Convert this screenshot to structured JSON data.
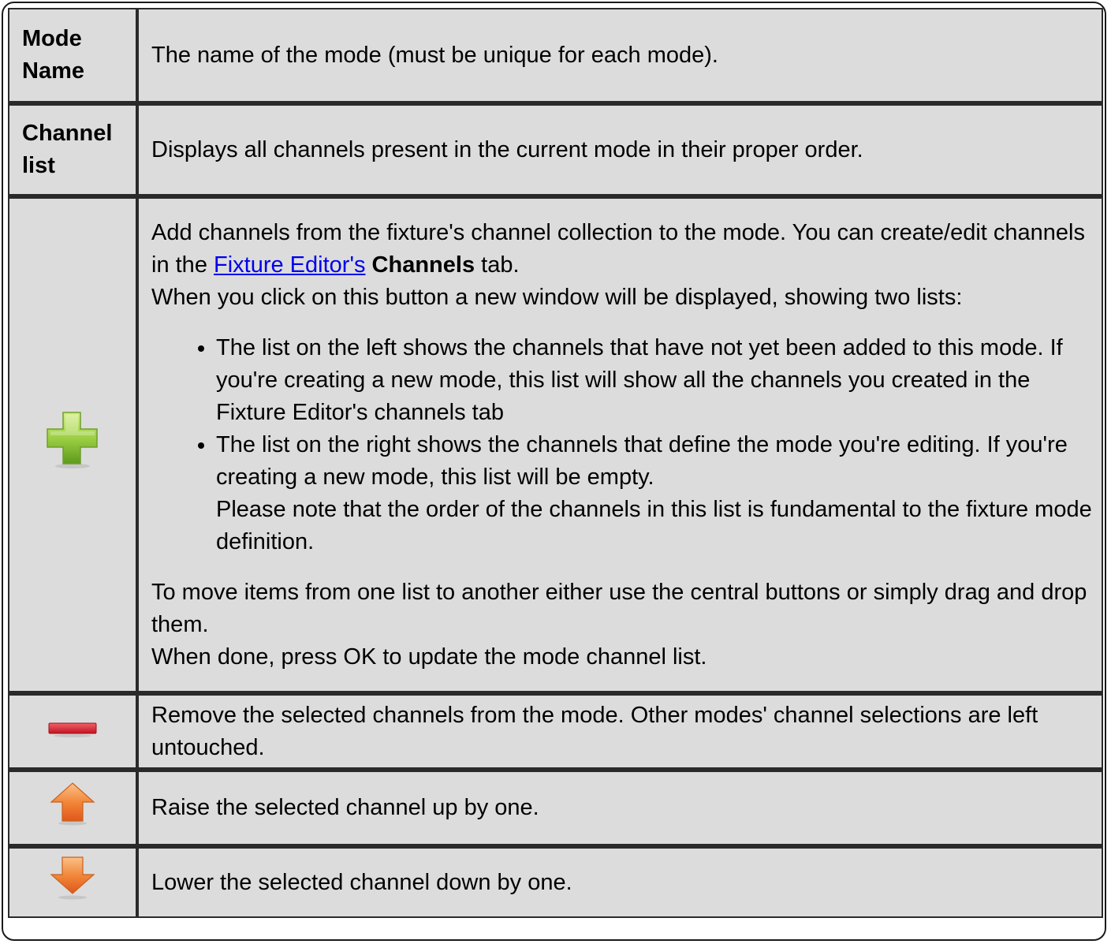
{
  "rows": [
    {
      "key": "Mode Name",
      "desc": "The name of the mode (must be unique for each mode)."
    },
    {
      "key": "Channel list",
      "desc": "Displays all channels present in the current mode in their proper order."
    },
    {
      "icon": "add-plus-icon",
      "para1_before": "Add channels from the fixture's channel collection to the mode. You can create/edit channels in the ",
      "link": "Fixture Editor's",
      "para1_space": " ",
      "bold": "Channels",
      "para1_after": " tab.",
      "para2": "When you click on this button a new window will be displayed, showing two lists:",
      "bullets": [
        {
          "text": "The list on the left shows the channels that have not yet been added to this mode. If you're creating a new mode, this list will show all the channels you created in the Fixture Editor's channels tab"
        },
        {
          "text": "The list on the right shows the channels that define the mode you're editing. If you're creating a new mode, this list will be empty.",
          "note": "Please note that the order of the channels in this list is fundamental to the fixture mode definition."
        }
      ],
      "para3": "To move items from one list to another either use the central buttons or simply drag and drop them.",
      "para4": "When done, press OK to update the mode channel list."
    },
    {
      "icon": "remove-minus-icon",
      "desc": "Remove the selected channels from the mode. Other modes' channel selections are left untouched."
    },
    {
      "icon": "raise-arrow-up-icon",
      "desc": "Raise the selected channel up by one."
    },
    {
      "icon": "lower-arrow-down-icon",
      "desc": "Lower the selected channel down by one."
    }
  ],
  "colors": {
    "cell_bg": "#dcdcdc",
    "border": "#2a2a2a",
    "link": "#0000ee",
    "plus_green": "#8cc63f",
    "minus_red": "#d9232e",
    "arrow_orange": "#f07a1f"
  }
}
